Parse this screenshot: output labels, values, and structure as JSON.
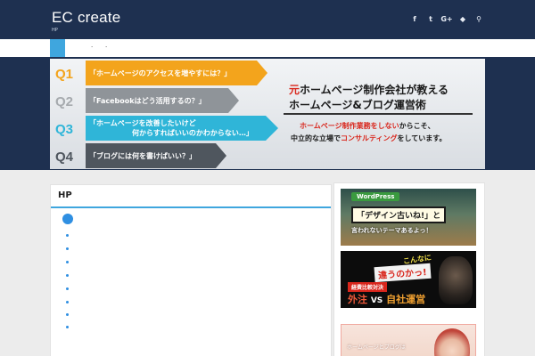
{
  "header": {
    "site_title": "EC create",
    "site_subtitle": "HP",
    "social_icons": [
      {
        "name": "facebook-icon",
        "glyph": "f"
      },
      {
        "name": "twitter-icon",
        "glyph": "t"
      },
      {
        "name": "google-plus-icon",
        "glyph": "G+"
      },
      {
        "name": "feedly-icon",
        "glyph": "◆"
      },
      {
        "name": "search-icon",
        "glyph": "⚲"
      }
    ]
  },
  "nav": {
    "dots": [
      "·",
      "·"
    ]
  },
  "banner": {
    "questions": [
      {
        "label": "Q1",
        "text": "「ホームページのアクセスを増やすには？」",
        "color": "#f3a41c"
      },
      {
        "label": "Q2",
        "text": "「Facebookはどう活用するの？」",
        "color": "#8f9499"
      },
      {
        "label": "Q3",
        "text": "「ホームページを改善したいけど",
        "text2": "何からすればいいのかわからない…」",
        "color": "#2fb5d8"
      },
      {
        "label": "Q4",
        "text": "「ブログには何を書けばいい？」",
        "color": "#4f565e"
      }
    ],
    "headline_red": "元",
    "headline_line1": "ホームページ制作会社が教える",
    "headline_line2": "ホームページ&ブログ運営術",
    "sub_line1_red": "ホームページ制作業務をしない",
    "sub_line1_black": "からこそ、",
    "sub_line2_black1": "中立的な立場で",
    "sub_line2_red": "コンサルティング",
    "sub_line2_black2": "をしています。"
  },
  "main": {
    "heading": "HP"
  },
  "sidebar": {
    "ad1": {
      "badge": "WordPress",
      "line1": "「デザイン古いね!」と",
      "line2": "言われないテーマあるよっ！"
    },
    "ad2": {
      "line1": "こんなに",
      "line2": "違うのかっ!",
      "tag": "経費比較対決",
      "left": "外注",
      "vs": "VS",
      "right": "自社運営"
    },
    "ad3": {
      "line1": "ホームページとブログは"
    }
  },
  "colors": {
    "navy": "#1e3050",
    "accent_blue": "#3fa6de",
    "red": "#d9261c"
  }
}
